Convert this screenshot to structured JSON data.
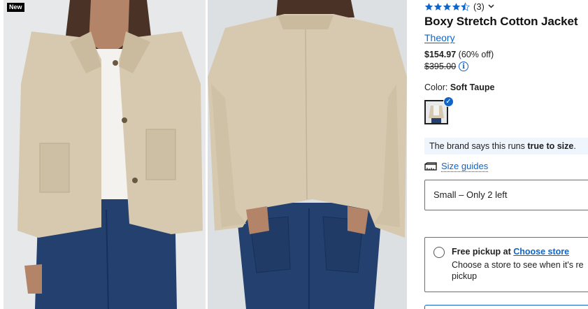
{
  "gallery": {
    "badge": "New"
  },
  "product": {
    "rating": {
      "stars": 4.5,
      "count": "(3)",
      "star_color": "#1064c7"
    },
    "title": "Boxy Stretch Cotton Jacket",
    "brand": "Theory",
    "price": {
      "current": "$154.97",
      "discount": "(60% off)",
      "original": "$395.00"
    },
    "color": {
      "label": "Color:",
      "value": "Soft Taupe"
    },
    "fit_note": {
      "prefix": "The brand says this runs ",
      "emphasis": "true to size",
      "suffix": "."
    },
    "size_guides": "Size guides",
    "size_select": "Small – Only 2 left",
    "pickup": {
      "title": "Free pickup at ",
      "link": "Choose store",
      "desc_line1": "Choose a store to see when it's re",
      "desc_line2": "pickup"
    }
  },
  "colors": {
    "accent": "#1064c7",
    "jacket": "#d6c9b0",
    "denim": "#23406e"
  }
}
